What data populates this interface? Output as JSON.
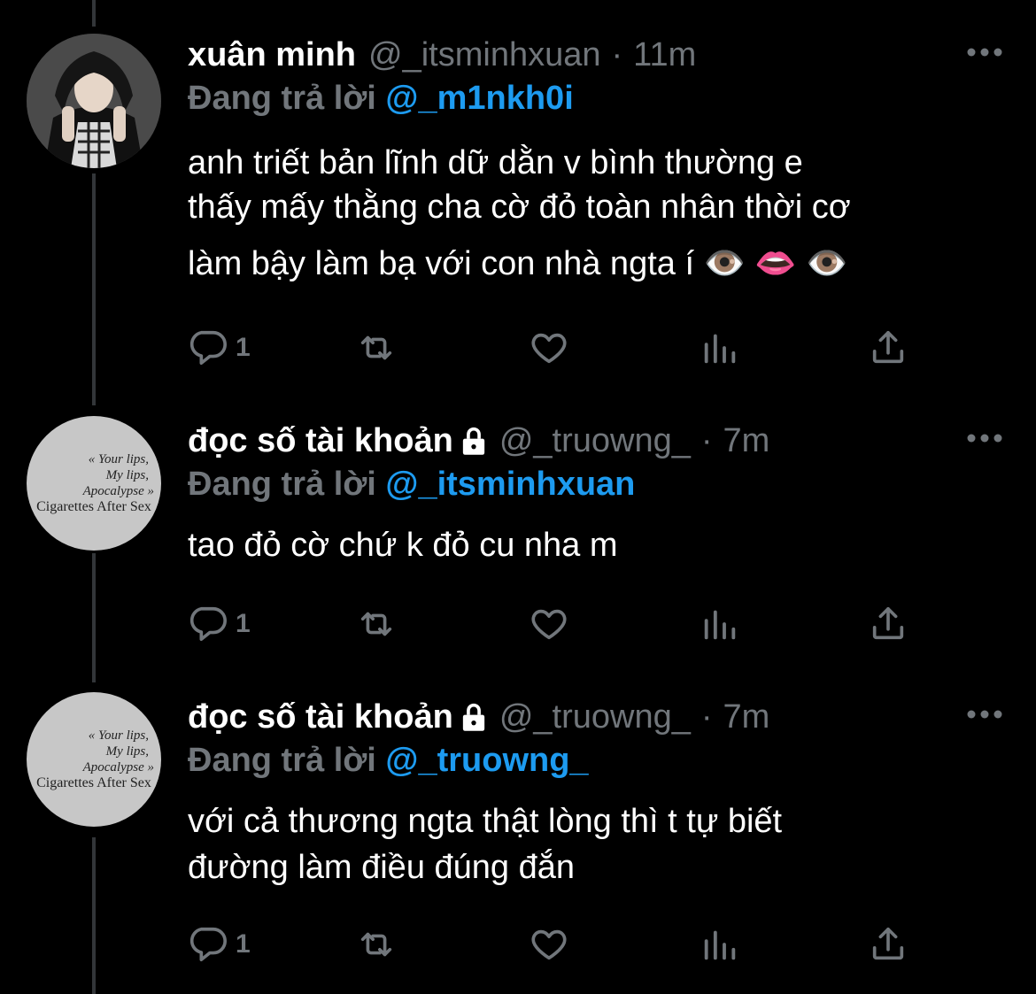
{
  "reply_prefix": "Đang trả lời",
  "tweets": [
    {
      "name": "xuân minh",
      "handle": "@_itsminhxuan",
      "separator": "·",
      "time": "11m",
      "reply_to": "@_m1nkh0i",
      "text_lines": [
        "anh triết bản lĩnh dữ dằn v bình thường e",
        "thấy mấy thằng cha cờ đỏ toàn nhân thời cơ",
        "làm bậy làm bạ với con nhà ngta í 👁️ 👄 👁️"
      ],
      "reply_count": "1",
      "locked": false,
      "avatar": "photo"
    },
    {
      "name": "đọc số tài khoản",
      "handle": "@_truowng_",
      "separator": "·",
      "time": "7m",
      "reply_to": "@_itsminhxuan",
      "text_lines": [
        "tao đỏ cờ chứ k đỏ cu nha m"
      ],
      "reply_count": "1",
      "locked": true,
      "avatar": "text"
    },
    {
      "name": "đọc số tài khoản",
      "handle": "@_truowng_",
      "separator": "·",
      "time": "7m",
      "reply_to": "@_truowng_",
      "text_lines": [
        "với cả thương ngta thật lòng thì t tự biết",
        "đường làm điều đúng đắn"
      ],
      "reply_count": "1",
      "locked": true,
      "avatar": "text"
    }
  ],
  "avatar_caption": {
    "line1": "« Your lips,",
    "line2": "My lips,",
    "line3": "Apocalypse »",
    "line4": "Cigarettes After Sex"
  },
  "icons": {
    "reply": "reply-icon",
    "retweet": "retweet-icon",
    "like": "heart-icon",
    "views": "views-icon",
    "share": "share-icon",
    "more": "more-dots-icon",
    "lock": "lock-icon"
  },
  "colors": {
    "background": "#000000",
    "text": "#ffffff",
    "muted": "#71767b",
    "mention": "#1d9bf0"
  }
}
